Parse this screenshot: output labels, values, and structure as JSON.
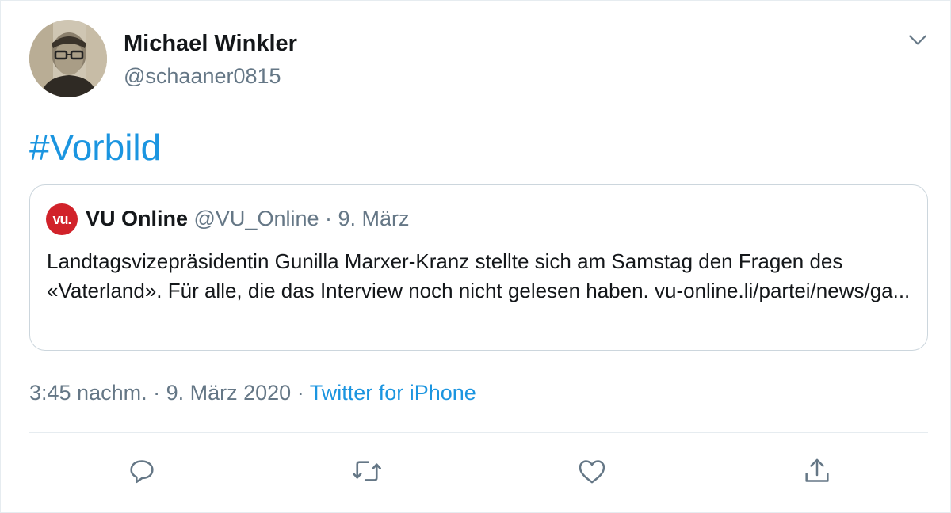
{
  "tweet": {
    "author_name": "Michael Winkler",
    "author_handle": "@schaaner0815",
    "hashtag": "#Vorbild",
    "time": "3:45 nachm.",
    "dot1": " · ",
    "date": "9. März 2020",
    "dot2": " · ",
    "source": "Twitter for iPhone"
  },
  "quoted": {
    "logo_text": "vu.",
    "name": "VU Online",
    "meta": " @VU_Online · 9. März",
    "text": "Landtagsvizepräsidentin Gunilla Marxer-Kranz stellte sich am Samstag den Fragen des «Vaterland». Für alle, die das Interview noch nicht gelesen haben. vu-online.li/partei/news/ga..."
  },
  "icons": {
    "menu": "chevron-down-icon",
    "reply": "reply-icon",
    "retweet": "retweet-icon",
    "like": "heart-icon",
    "share": "share-icon"
  },
  "colors": {
    "link": "#1b95e0",
    "secondary_text": "#657786",
    "logo_red": "#d1222a",
    "border": "#ccd6dd"
  }
}
